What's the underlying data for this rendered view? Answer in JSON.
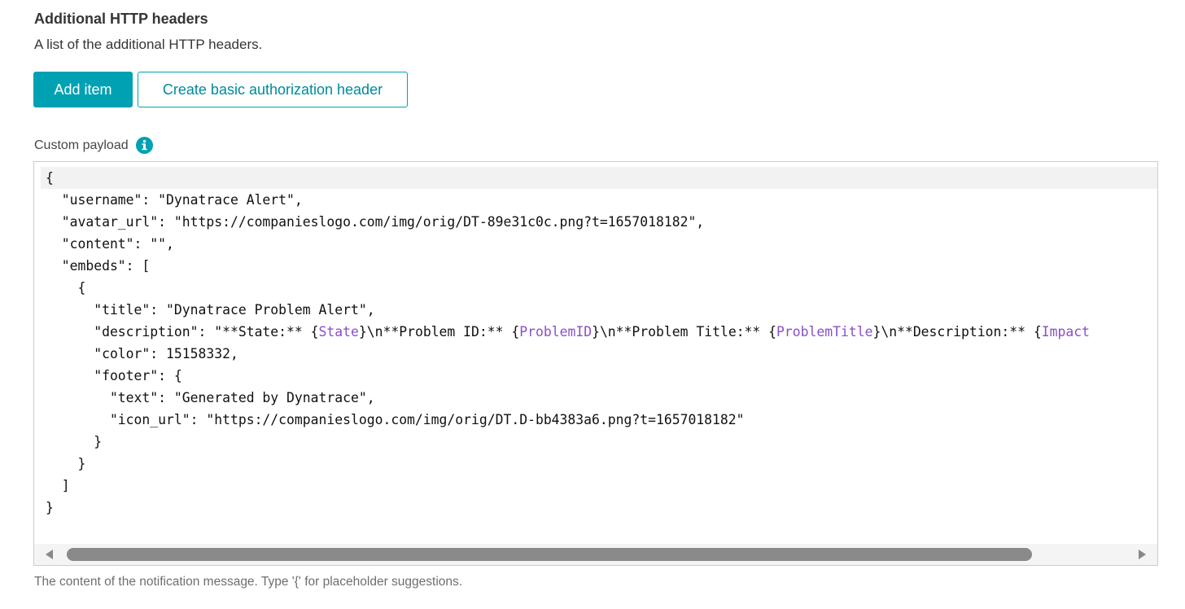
{
  "section": {
    "title": "Additional HTTP headers",
    "description": "A list of the additional HTTP headers."
  },
  "buttons": {
    "add_item": "Add item",
    "create_basic_auth": "Create basic authorization header"
  },
  "payload": {
    "label": "Custom payload",
    "info_icon": "info-icon",
    "helper_text": "The content of the notification message. Type '{' for placeholder suggestions.",
    "lines": [
      "{",
      "  \"username\": \"Dynatrace Alert\",",
      "  \"avatar_url\": \"https://companieslogo.com/img/orig/DT-89e31c0c.png?t=1657018182\",",
      "  \"content\": \"\",",
      "  \"embeds\": [",
      "    {",
      "      \"title\": \"Dynatrace Problem Alert\",",
      "      \"description\": \"**State:** {State}\\n**Problem ID:** {ProblemID}\\n**Problem Title:** {ProblemTitle}\\n**Description:** {Impact",
      "      \"color\": 15158332,",
      "      \"footer\": {",
      "        \"text\": \"Generated by Dynatrace\",",
      "        \"icon_url\": \"https://companieslogo.com/img/orig/DT.D-bb4383a6.png?t=1657018182\"",
      "      }",
      "    }",
      "  ]",
      "}"
    ],
    "placeholders": [
      "{State}",
      "{ProblemID}",
      "{ProblemTitle}",
      "{Impact"
    ]
  },
  "colors": {
    "accent": "#00a1b2",
    "placeholder": "#8a4fc7"
  }
}
